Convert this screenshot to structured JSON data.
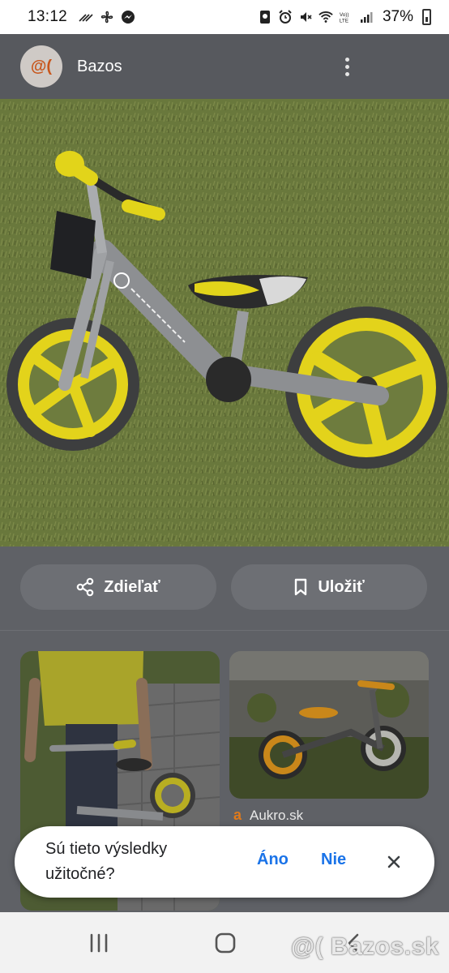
{
  "status_bar": {
    "time": "13:12",
    "battery": "37%",
    "left_icons": [
      "data-saver-icon",
      "fan-icon",
      "messenger-icon"
    ],
    "right_icons": [
      "app-notification-icon",
      "alarm-icon",
      "mute-icon",
      "wifi-icon",
      "volte-icon",
      "signal-icon"
    ]
  },
  "header": {
    "logo_text": "@(",
    "site_name": "Bazos",
    "more_icon": "more-vert-icon"
  },
  "actions": {
    "share_label": "Zdieľať",
    "save_label": "Uložiť"
  },
  "results": [
    {
      "image": "person-with-balance-bike"
    },
    {
      "image": "balance-bike-in-garden",
      "source": "Aukro.sk"
    }
  ],
  "feedback": {
    "question": "Sú tieto výsledky užitočné?",
    "yes": "Áno",
    "no": "Nie"
  },
  "watermark": "@( Bazos.sk",
  "colors": {
    "accent": "#1a73e8",
    "header_bg": "#57595e",
    "bike_yellow": "#e2d41a",
    "logo_orange": "#c8561c"
  }
}
